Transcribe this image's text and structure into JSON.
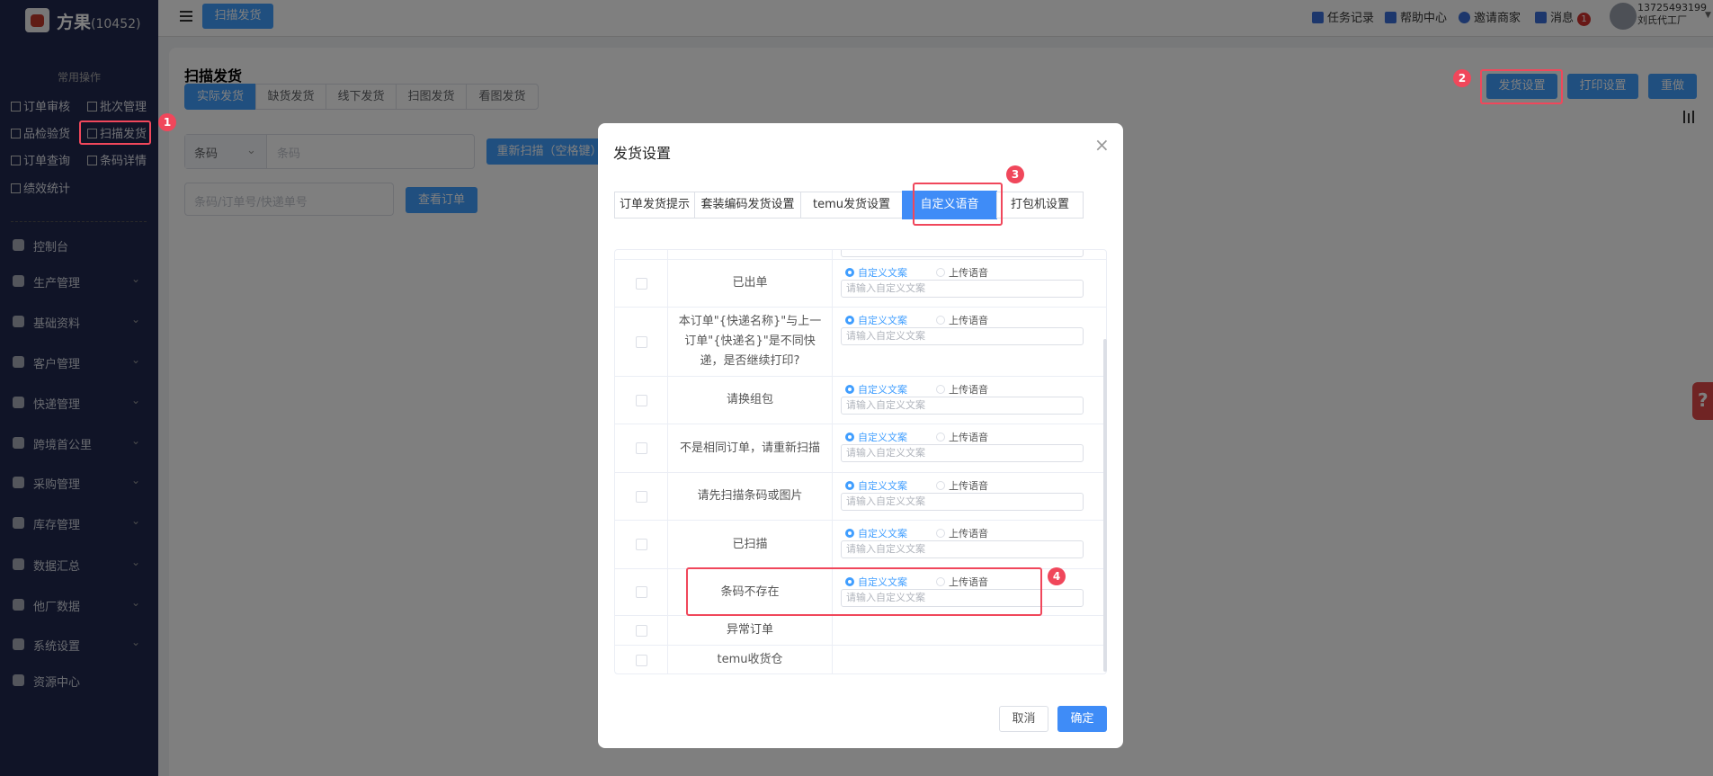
{
  "sidebar": {
    "brand": "方果",
    "brand_id": "(10452)",
    "quick_title": "常用操作",
    "quick": [
      "订单审核",
      "批次管理",
      "品检验货",
      "扫描发货",
      "订单查询",
      "条码详情",
      "绩效统计"
    ],
    "menu": [
      "控制台",
      "生产管理",
      "基础资料",
      "客户管理",
      "快递管理",
      "跨境首公里",
      "采购管理",
      "库存管理",
      "数据汇总",
      "他厂数据",
      "系统设置",
      "资源中心"
    ]
  },
  "header": {
    "active_tab": "扫描发货",
    "items": [
      "任务记录",
      "帮助中心",
      "邀请商家",
      "消息"
    ],
    "message_count": "1",
    "user_phone": "13725493199",
    "user_name": "刘氏代工厂"
  },
  "page": {
    "title": "扫描发货",
    "tabs": [
      "实际发货",
      "缺货发货",
      "线下发货",
      "扫图发货",
      "看图发货"
    ],
    "select_value": "条码",
    "barcode_placeholder": "条码",
    "rescan_label": "重新扫描（空格键）",
    "search_placeholder": "条码/订单号/快递单号",
    "view_order_label": "查看订单",
    "ship_settings_label": "发货设置",
    "print_settings_label": "打印设置",
    "redo_label": "重做"
  },
  "dialog": {
    "title": "发货设置",
    "tabs": [
      "订单发货提示",
      "套装编码发货设置",
      "temu发货设置",
      "自定义语音",
      "打包机设置"
    ],
    "active_tab": "自定义语音",
    "option_custom": "自定义文案",
    "option_upload": "上传语音",
    "input_placeholder": "请输入自定义文案",
    "rows": [
      {
        "label": "已出单",
        "has_options": true
      },
      {
        "label": "本订单\"{快递名称}\"与上一订单\"{快递名}\"是不同快递，是否继续打印?",
        "has_options": true
      },
      {
        "label": "请换组包",
        "has_options": true
      },
      {
        "label": "不是相同订单，请重新扫描",
        "has_options": true
      },
      {
        "label": "请先扫描条码或图片",
        "has_options": true
      },
      {
        "label": "已扫描",
        "has_options": true
      },
      {
        "label": "条码不存在",
        "has_options": true
      },
      {
        "label": "异常订单",
        "has_options": false
      },
      {
        "label": "temu收货仓",
        "has_options": false
      }
    ],
    "cancel_label": "取消",
    "confirm_label": "确定"
  },
  "annotations": [
    "1",
    "2",
    "3",
    "4"
  ],
  "colors": {
    "primary": "#409eff",
    "sidebar": "#20284f",
    "annotation": "#f0475b"
  }
}
